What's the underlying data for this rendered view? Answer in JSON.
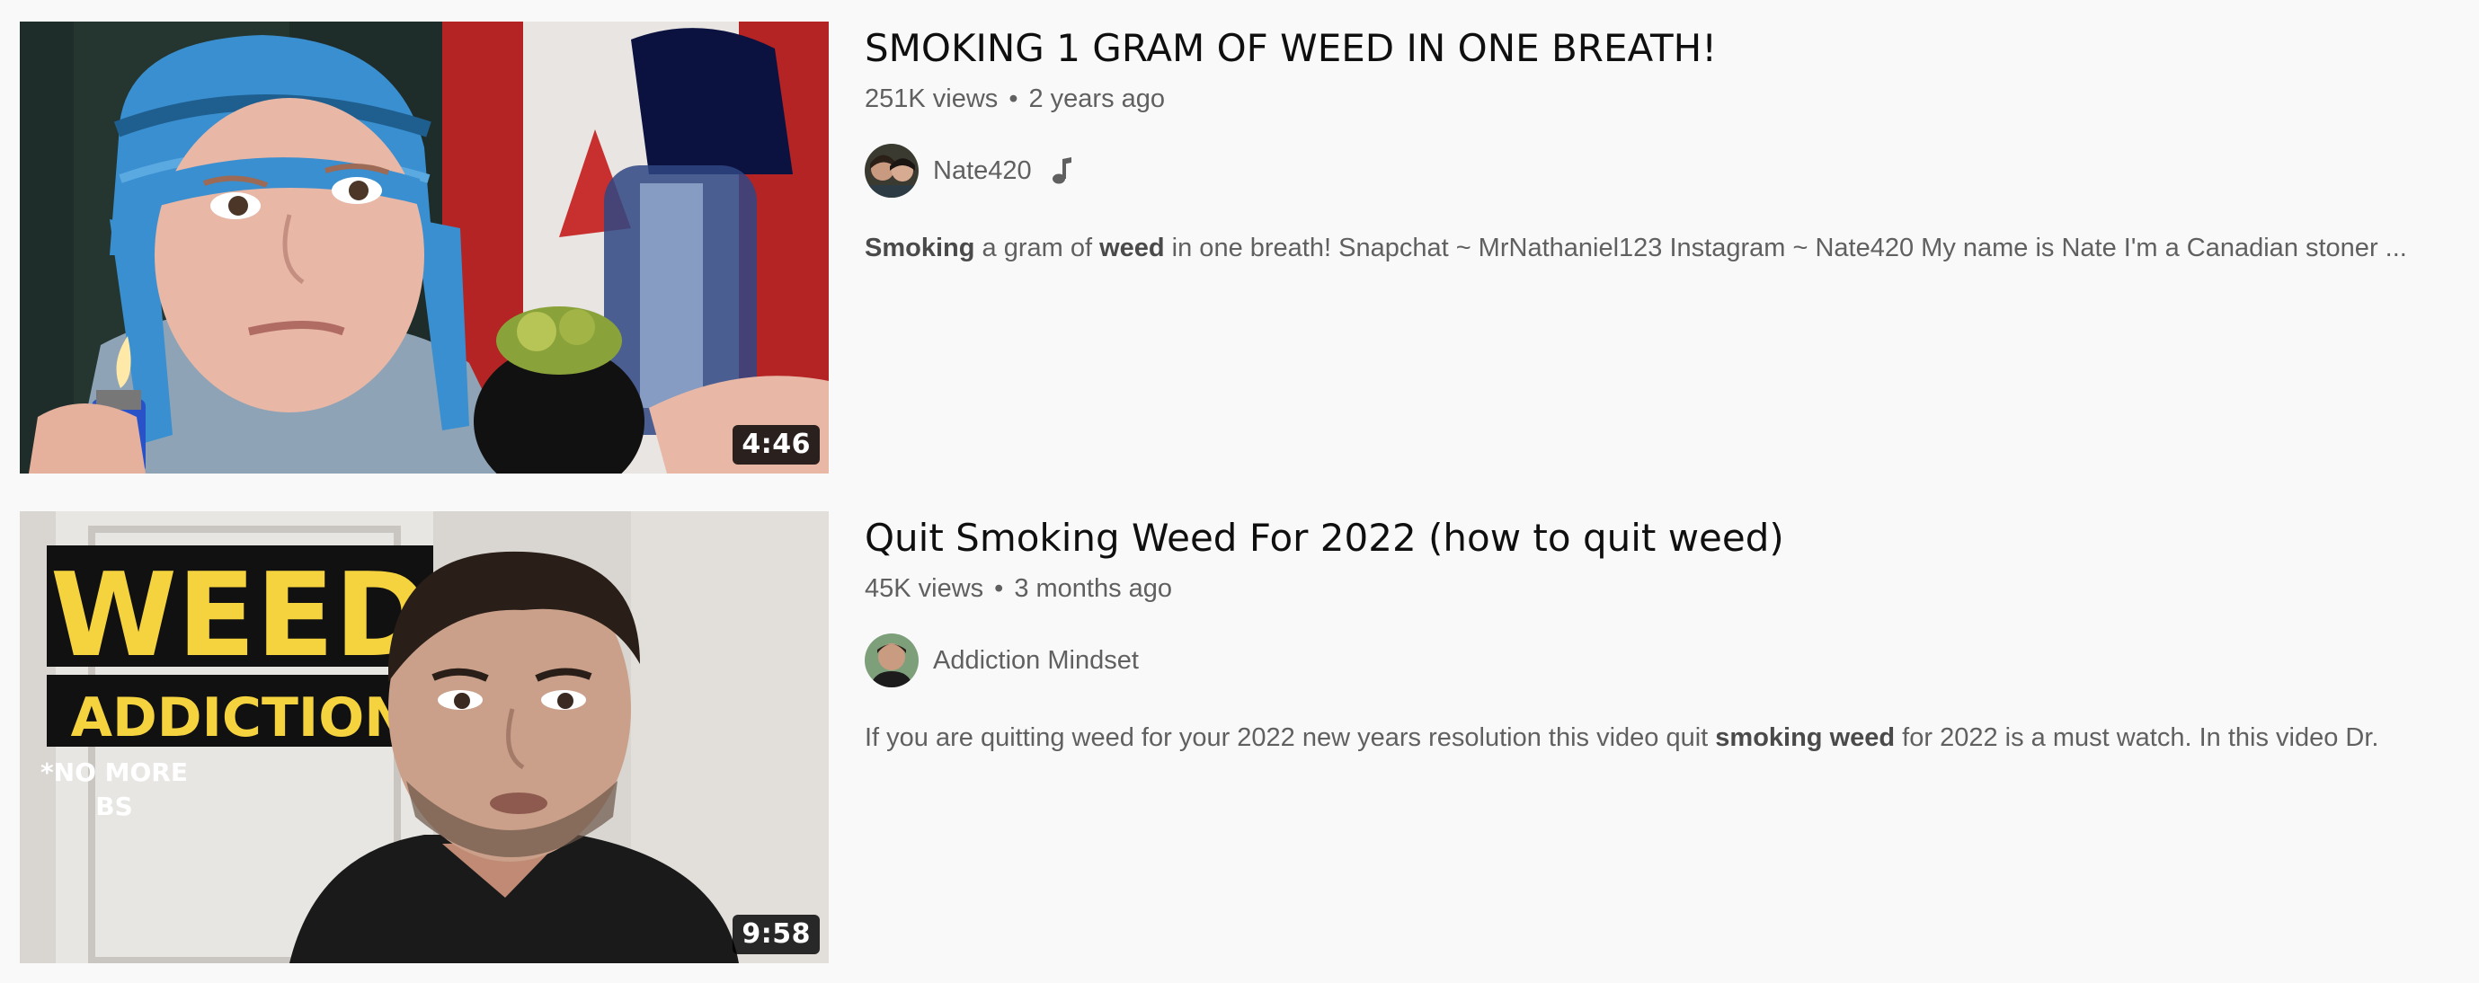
{
  "results": [
    {
      "title": "SMOKING 1 GRAM OF WEED IN ONE BREATH!",
      "views": "251K views",
      "age": "2 years ago",
      "separator": "•",
      "channel": "Nate420",
      "channel_badge_icon": "music-note-icon",
      "duration": "4:46",
      "description": [
        {
          "text": "Smoking",
          "bold": true
        },
        {
          "text": " a gram of ",
          "bold": false
        },
        {
          "text": "weed",
          "bold": true
        },
        {
          "text": " in one breath! Snapchat ~ MrNathaniel123 Instagram ~ Nate420 My name is Nate I'm a Canadian stoner ...",
          "bold": false
        }
      ]
    },
    {
      "title": "Quit Smoking Weed For 2022 (how to quit weed)",
      "views": "45K views",
      "age": "3 months ago",
      "separator": "•",
      "channel": "Addiction Mindset",
      "duration": "9:58",
      "thumbnail_text": {
        "line1": "WEED",
        "line2": "ADDICTION",
        "line3": "*NO MORE",
        "line4": "BS"
      },
      "description": [
        {
          "text": "If you are quitting weed for your 2022 new years resolution this video quit ",
          "bold": false
        },
        {
          "text": "smoking weed",
          "bold": true
        },
        {
          "text": " for 2022 is a must watch. In this video Dr.",
          "bold": false
        }
      ]
    }
  ],
  "colors": {
    "page_background": "#f9f9f9",
    "title": "#0f0f0f",
    "meta": "#606060",
    "thumbnail_banner_yellow": "#f5d33f"
  }
}
